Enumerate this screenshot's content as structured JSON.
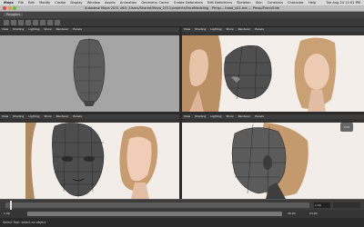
{
  "menubar": {
    "app": "Maya",
    "items": [
      "File",
      "Edit",
      "Modify",
      "Create",
      "Display",
      "Window",
      "Assets",
      "Animation",
      "Geometry Cache",
      "Create Deformers",
      "Edit Deformers",
      "Skeleton",
      "Skin",
      "Constrain",
      "Character",
      "Help"
    ],
    "right": "Tue Aug 24 11:01 PM"
  },
  "titlebar": {
    "title": "Autodesk Maya 2011 x64: /Users/Shared/Maya_2011/projects/FaceModeling - Persp... head_v01.ma  --- Persp/Front/Side"
  },
  "statusline": {
    "mode": "Polygons"
  },
  "panel_menu": [
    "View",
    "Shading",
    "Lighting",
    "Show",
    "Renderer",
    "Panels"
  ],
  "timeline": {
    "start": "1.00",
    "end": "24.00",
    "current": "1.00"
  },
  "range": {
    "start": "1.00",
    "end": "48.00",
    "left": "1.00",
    "right": "24.00"
  },
  "sidebutton": {
    "label": "Edit"
  },
  "helpline": {
    "text": "Select Tool: select an object"
  }
}
